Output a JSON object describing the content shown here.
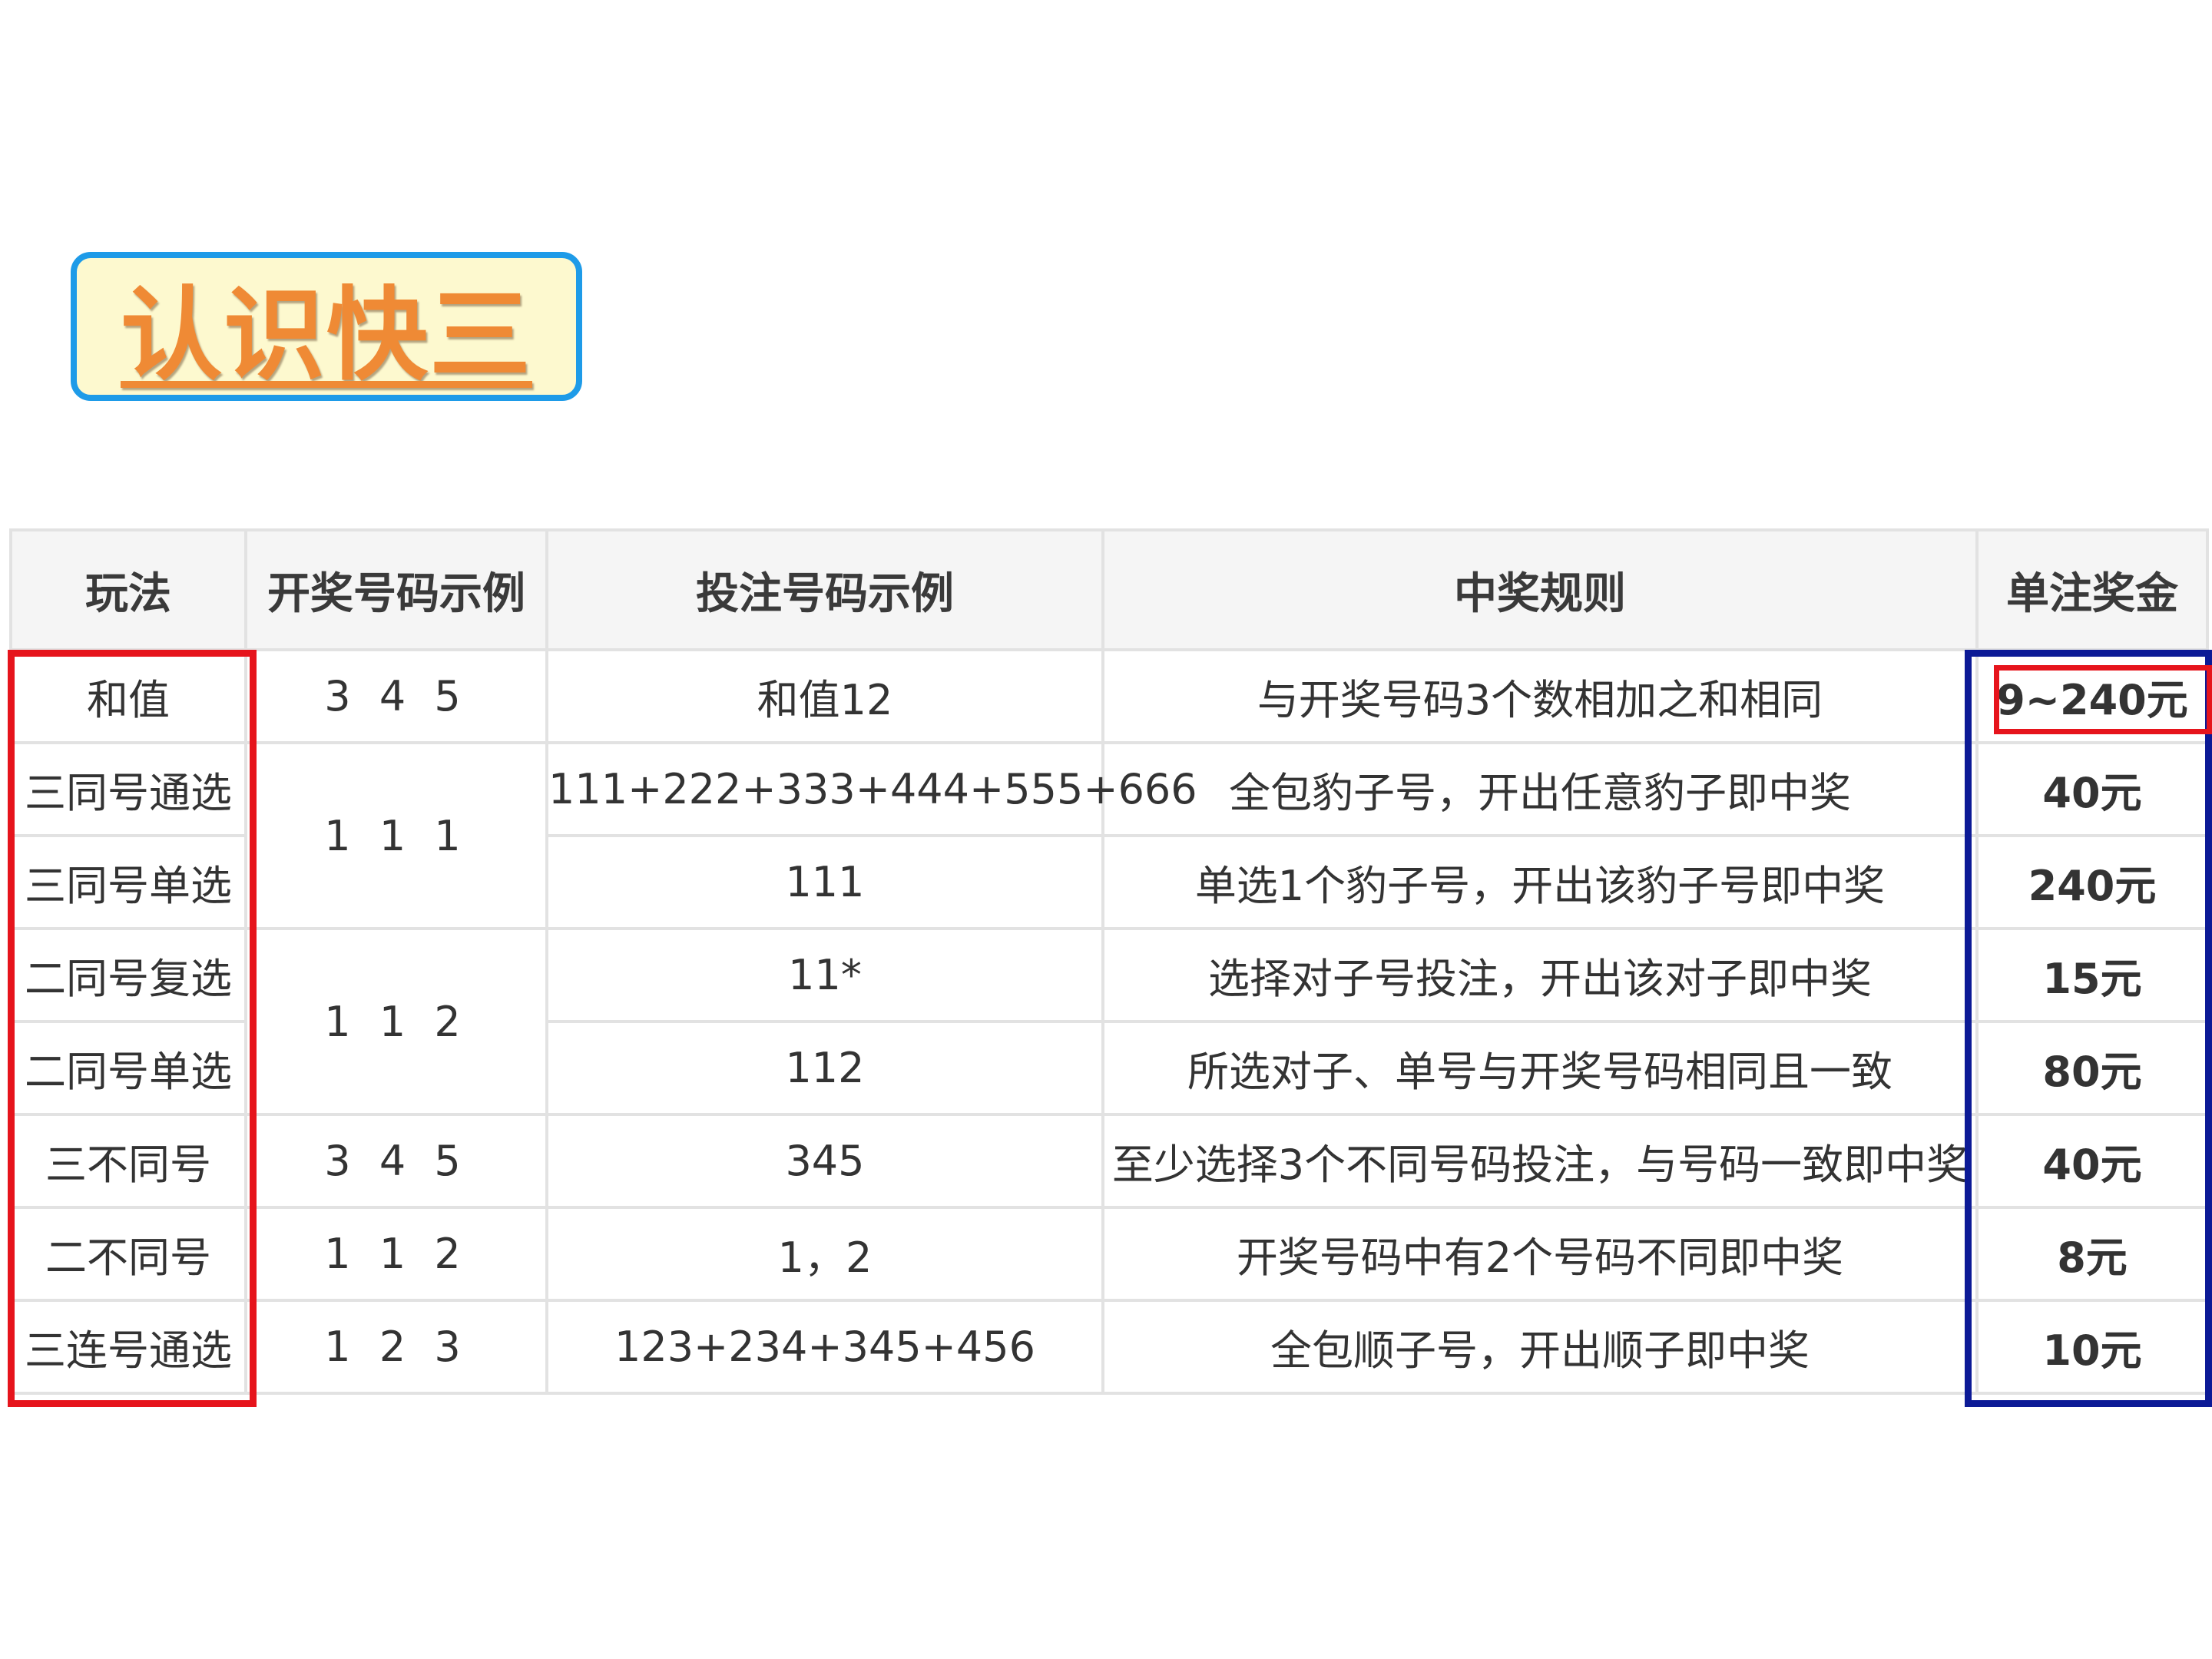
{
  "title": "认识快三",
  "table": {
    "headers": [
      "玩法",
      "开奖号码示例",
      "投注号码示例",
      "中奖规则",
      "单注奖金"
    ],
    "rows": [
      {
        "play": "和值",
        "draw": "3 4 5",
        "bet": "和值12",
        "rule": "与开奖号码3个数相加之和相同",
        "prize": "9~240元"
      },
      {
        "play": "三同号通选",
        "draw": "1 1 1",
        "bet": "111+222+333+444+555+666",
        "rule": "全包豹子号，开出任意豹子即中奖",
        "prize": "40元"
      },
      {
        "play": "三同号单选",
        "bet": "111",
        "rule": "单选1个豹子号，开出该豹子号即中奖",
        "prize": "240元"
      },
      {
        "play": "二同号复选",
        "draw": "1 1 2",
        "bet": "11*",
        "rule": "选择对子号投注，开出该对子即中奖",
        "prize": "15元"
      },
      {
        "play": "二同号单选",
        "bet": "112",
        "rule": "所选对子、单号与开奖号码相同且一致",
        "prize": "80元"
      },
      {
        "play": "三不同号",
        "draw": "3 4 5",
        "bet": "345",
        "rule": "至少选择3个不同号码投注，与号码一致即中奖",
        "prize": "40元"
      },
      {
        "play": "二不同号",
        "draw": "1 1 2",
        "bet": "1，2",
        "rule": "开奖号码中有2个号码不同即中奖",
        "prize": "8元"
      },
      {
        "play": "三连号通选",
        "draw": "1 2 3",
        "bet": "123+234+345+456",
        "rule": "全包顺子号，开出顺子即中奖",
        "prize": "10元"
      }
    ]
  },
  "colors": {
    "title_text": "#ef8a35",
    "title_border": "#1e9be8",
    "title_bg": "#fdf9cf",
    "prize_text": "#e31b1b",
    "highlight_red": "#e6141c",
    "highlight_blue": "#0c1a96"
  }
}
